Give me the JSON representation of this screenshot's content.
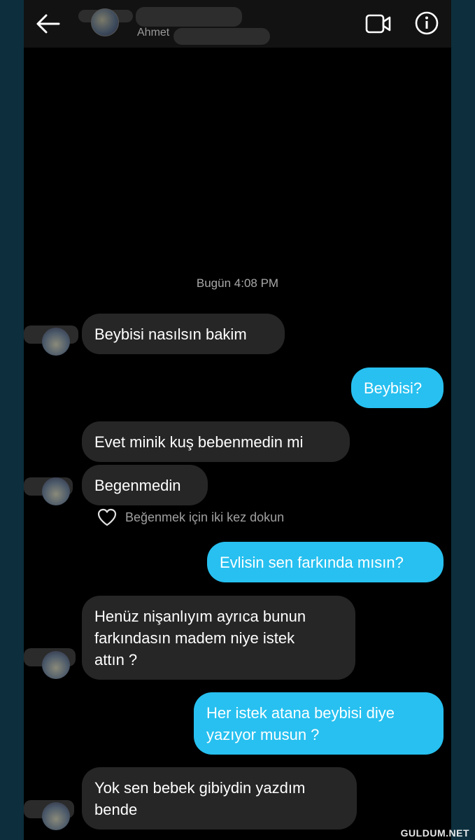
{
  "header": {
    "contact_name": "Ahmet"
  },
  "chat": {
    "timestamp": "Bugün 4:08 PM",
    "messages": [
      {
        "from": "them",
        "text": "Beybisi nasılsın bakim"
      },
      {
        "from": "me",
        "text": "Beybisi?"
      },
      {
        "from": "them",
        "text": "Evet minik kuş bebenmedin mi"
      },
      {
        "from": "them",
        "text": "Begenmedin"
      },
      {
        "from": "me",
        "text": "Evlisin sen farkında mısın?"
      },
      {
        "from": "them",
        "text": "Henüz nişanlıyım ayrıca bunun\nfarkındasın madem niye istek\nattın ?"
      },
      {
        "from": "me",
        "text": "Her istek atana beybisi diye\nyazıyor musun ?"
      },
      {
        "from": "them",
        "text": "Yok sen bebek gibiydin yazdım\nbende"
      }
    ],
    "like_hint": "Beğenmek için iki kez dokun"
  },
  "watermark": "GULDUM.NET",
  "colors": {
    "outgoing_bubble": "#27c0f0",
    "incoming_bubble": "#262626",
    "background": "#000000"
  }
}
